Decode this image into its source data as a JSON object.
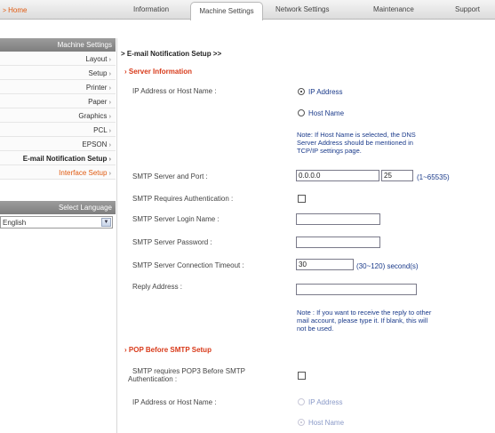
{
  "nav": {
    "home": "Home",
    "tabs": [
      "Information",
      "Machine Settings",
      "Network Settings",
      "Maintenance",
      "Support"
    ],
    "active_tab": "Machine Settings"
  },
  "sidebar": {
    "header": "Machine Settings",
    "items": [
      "Layout",
      "Setup",
      "Printer",
      "Paper",
      "Graphics",
      "PCL",
      "EPSON",
      "E-mail Notification Setup",
      "Interface Setup"
    ],
    "language_header": "Select Language",
    "language_value": "English"
  },
  "main": {
    "title": "E-mail Notification Setup >>",
    "server_section": "Server Information",
    "ip_label": "IP Address or Host Name :",
    "ip_option": "IP Address",
    "host_option": "Host Name",
    "note1": [
      "Note: If Host Name is selected, the DNS",
      "Server Address should be mentioned in",
      "TCP/IP settings page."
    ],
    "smtp_server_label": "SMTP Server and Port :",
    "smtp_server_value": "0.0.0.0",
    "smtp_port_value": "25",
    "smtp_port_range": "(1~65535)",
    "auth_label": "SMTP Requires Authentication :",
    "login_label": "SMTP Server Login Name :",
    "password_label": "SMTP Server Password :",
    "timeout_label": "SMTP Server Connection Timeout :",
    "timeout_value": "30",
    "timeout_range": "(30~120) second(s)",
    "reply_label": "Reply Address :",
    "note2": [
      "Note : If you want to receive the reply to other",
      "mail account, please type it. If blank, this will",
      "not be used."
    ],
    "pop_section": "POP Before SMTP Setup",
    "pop_label": [
      "SMTP requires POP3 Before SMTP",
      "Authentication :"
    ],
    "pop_ip_label": "IP Address or Host Name :",
    "pop_ip_option": "IP Address",
    "pop_host_option": "Host Name"
  },
  "colors": {
    "accent": "#e05a10",
    "section": "#d83a1a",
    "link_blue": "#1a3a8a"
  }
}
